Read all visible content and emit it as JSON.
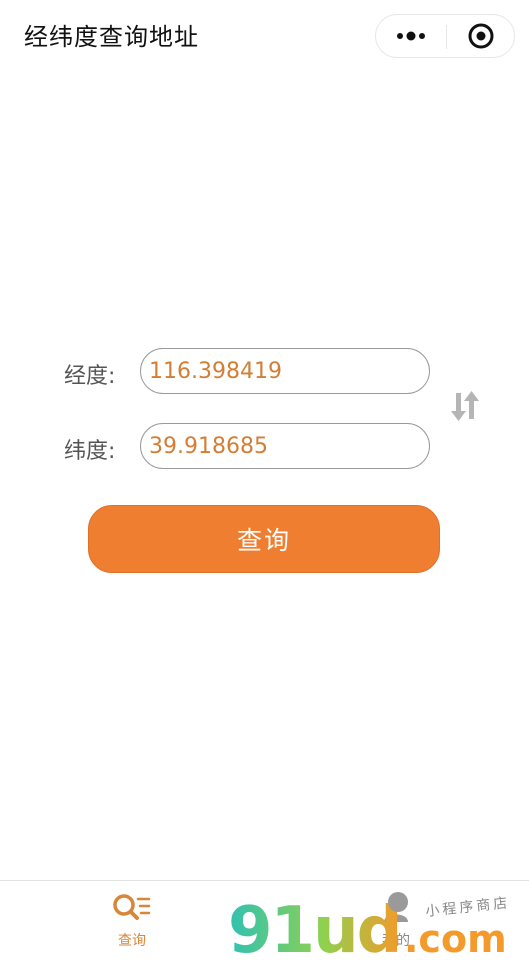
{
  "header": {
    "title": "经纬度查询地址",
    "more_icon": "more-dots-icon",
    "close_icon": "target-circle-icon"
  },
  "form": {
    "longitude_label": "经度:",
    "longitude_value": "116.398419",
    "latitude_label": "纬度:",
    "latitude_value": "39.918685",
    "swap_icon": "swap-arrows-icon",
    "query_label": "查询"
  },
  "tabbar": {
    "items": [
      {
        "label": "查询",
        "icon": "search-list-icon",
        "active": true
      },
      {
        "label": "我的",
        "icon": "user-icon",
        "active": false
      }
    ]
  },
  "watermark": {
    "logo_text": "91ud.com",
    "subtitle": "小程序商店"
  },
  "colors": {
    "accent": "#ef7e31",
    "value_text": "#d47e35",
    "tab_active": "#d8873a",
    "watermark_green": "#8fd14f",
    "watermark_teal": "#2fc1b2"
  }
}
